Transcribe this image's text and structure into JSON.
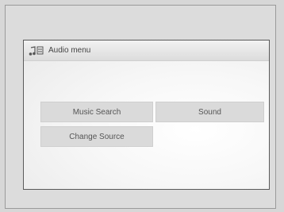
{
  "window": {
    "title": "Audio menu",
    "title_icon": "music-note-icon"
  },
  "buttons": {
    "music_search": "Music Search",
    "sound": "Sound",
    "change_source": "Change Source"
  },
  "colors": {
    "button_bg": "#dadada",
    "screen_border": "#5a5a5a",
    "title_text": "#444444"
  }
}
